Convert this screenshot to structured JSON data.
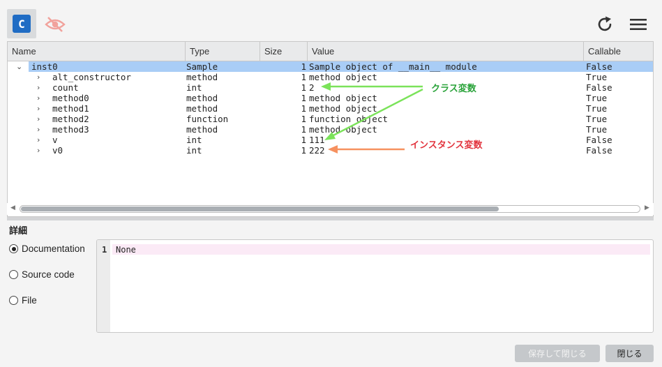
{
  "toolbar": {
    "class_button_letter": "C",
    "icons": [
      "class-icon",
      "eye-off-icon",
      "refresh-icon",
      "hamburger-menu-icon"
    ]
  },
  "table": {
    "columns": [
      "Name",
      "Type",
      "Size",
      "Value",
      "Callable"
    ],
    "rows": [
      {
        "expander": "⌄",
        "name": "inst0",
        "type": "Sample",
        "size": "1",
        "value": "Sample object of __main__ module",
        "callable": "False",
        "selected": true
      },
      {
        "expander": "›",
        "name": "alt_constructor",
        "type": "method",
        "size": "1",
        "value": "method object",
        "callable": "True"
      },
      {
        "expander": "›",
        "name": "count",
        "type": "int",
        "size": "1",
        "value": "2",
        "callable": "False"
      },
      {
        "expander": "›",
        "name": "method0",
        "type": "method",
        "size": "1",
        "value": "method object",
        "callable": "True"
      },
      {
        "expander": "›",
        "name": "method1",
        "type": "method",
        "size": "1",
        "value": "method object",
        "callable": "True"
      },
      {
        "expander": "›",
        "name": "method2",
        "type": "function",
        "size": "1",
        "value": "function object",
        "callable": "True"
      },
      {
        "expander": "›",
        "name": "method3",
        "type": "method",
        "size": "1",
        "value": "method object",
        "callable": "True"
      },
      {
        "expander": "›",
        "name": "v",
        "type": "int",
        "size": "1",
        "value": "111",
        "callable": "False"
      },
      {
        "expander": "›",
        "name": "v0",
        "type": "int",
        "size": "1",
        "value": "222",
        "callable": "False"
      }
    ]
  },
  "details": {
    "title": "詳細",
    "options": [
      {
        "label": "Documentation",
        "selected": true
      },
      {
        "label": "Source code",
        "selected": false
      },
      {
        "label": "File",
        "selected": false
      }
    ],
    "editor": {
      "line_number": "1",
      "code": "None"
    }
  },
  "buttons": {
    "save_close": "保存して閉じる",
    "close": "閉じる"
  },
  "annotations": {
    "class_var": "クラス変数",
    "instance_var": "インスタンス変数"
  },
  "colors": {
    "accent": "#1f6cc4",
    "selection": "#a9cdf6",
    "green_annotation": "#2aa33a",
    "red_annotation": "#e2343e",
    "green_arrow": "#7be35a",
    "orange_arrow": "#f6915f"
  }
}
